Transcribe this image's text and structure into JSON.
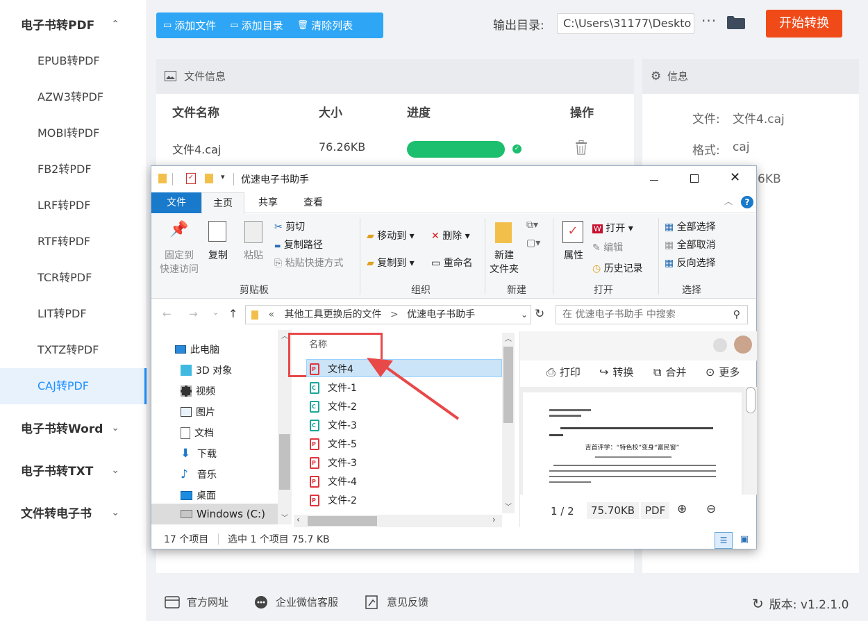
{
  "sidebar": {
    "groups": [
      {
        "label": "电子书转PDF",
        "chevron": "⌃"
      },
      {
        "label": "电子书转Word",
        "chevron": "⌄"
      },
      {
        "label": "电子书转TXT",
        "chevron": "⌄"
      },
      {
        "label": "文件转电子书",
        "chevron": "⌄"
      }
    ],
    "items": [
      "EPUB转PDF",
      "AZW3转PDF",
      "MOBI转PDF",
      "FB2转PDF",
      "LRF转PDF",
      "RTF转PDF",
      "TCR转PDF",
      "LIT转PDF",
      "TXTZ转PDF",
      "CAJ转PDF"
    ],
    "active_item": "CAJ转PDF"
  },
  "toolbar": {
    "add_file": "添加文件",
    "add_dir": "添加目录",
    "clear_list": "清除列表",
    "output_label": "输出目录:",
    "output_path": "C:\\Users\\31177\\Deskto",
    "more": "···",
    "start": "开始转换"
  },
  "file_panel": {
    "title": "文件信息",
    "columns": [
      "文件名称",
      "大小",
      "进度",
      "操作"
    ],
    "row": {
      "name": "文件4.caj",
      "size": "76.26KB",
      "progress": 1.0
    }
  },
  "info_panel": {
    "title": "信息",
    "file_label": "文件:",
    "file_value": "文件4.caj",
    "format_label": "格式:",
    "format_value": "caj",
    "size_partial": "6KB"
  },
  "bottom": {
    "website": "官方网址",
    "wechat": "企业微信客服",
    "feedback": "意见反馈",
    "version": "版本:  v1.2.1.0"
  },
  "explorer": {
    "title": "优速电子书助手",
    "tabs": [
      "文件",
      "主页",
      "共享",
      "查看"
    ],
    "ribbon": {
      "pin": "固定到\n快速访问",
      "copy": "复制",
      "paste": "粘贴",
      "cut": "剪切",
      "copy_path": "复制路径",
      "paste_shortcut": "粘贴快捷方式",
      "clipboard": "剪贴板",
      "move_to": "移动到",
      "copy_to": "复制到",
      "delete": "删除",
      "rename": "重命名",
      "organize": "组织",
      "new_folder": "新建\n文件夹",
      "new": "新建",
      "properties": "属性",
      "open": "打开",
      "edit": "编辑",
      "history": "历史记录",
      "open_group": "打开",
      "select_all": "全部选择",
      "select_none": "全部取消",
      "invert": "反向选择",
      "select": "选择"
    },
    "address": {
      "chevrons": "«",
      "part1": "其他工具更换后的文件",
      "sep": ">",
      "part2": "优速电子书助手"
    },
    "search_placeholder": "在 优速电子书助手 中搜索",
    "nav": [
      "此电脑",
      "3D 对象",
      "视频",
      "图片",
      "文档",
      "下载",
      "音乐",
      "桌面",
      "Windows (C:)"
    ],
    "list_header": "名称",
    "files": [
      {
        "name": "文件4",
        "type": "red",
        "selected": true
      },
      {
        "name": "文件-1",
        "type": "teal"
      },
      {
        "name": "文件-2",
        "type": "teal"
      },
      {
        "name": "文件-3",
        "type": "teal"
      },
      {
        "name": "文件-5",
        "type": "red"
      },
      {
        "name": "文件-3",
        "type": "red"
      },
      {
        "name": "文件-4",
        "type": "red"
      },
      {
        "name": "文件-2",
        "type": "red"
      }
    ],
    "preview": {
      "print": "打印",
      "convert": "转换",
      "merge": "合并",
      "more": "更多",
      "page": "1 / 2",
      "size": "75.70KB",
      "format": "PDF",
      "doc_title": "吉首评学：“特色校”变身“富民窗”"
    },
    "status": {
      "count": "17 个项目",
      "selected": "选中 1 个项目  75.7 KB"
    }
  }
}
